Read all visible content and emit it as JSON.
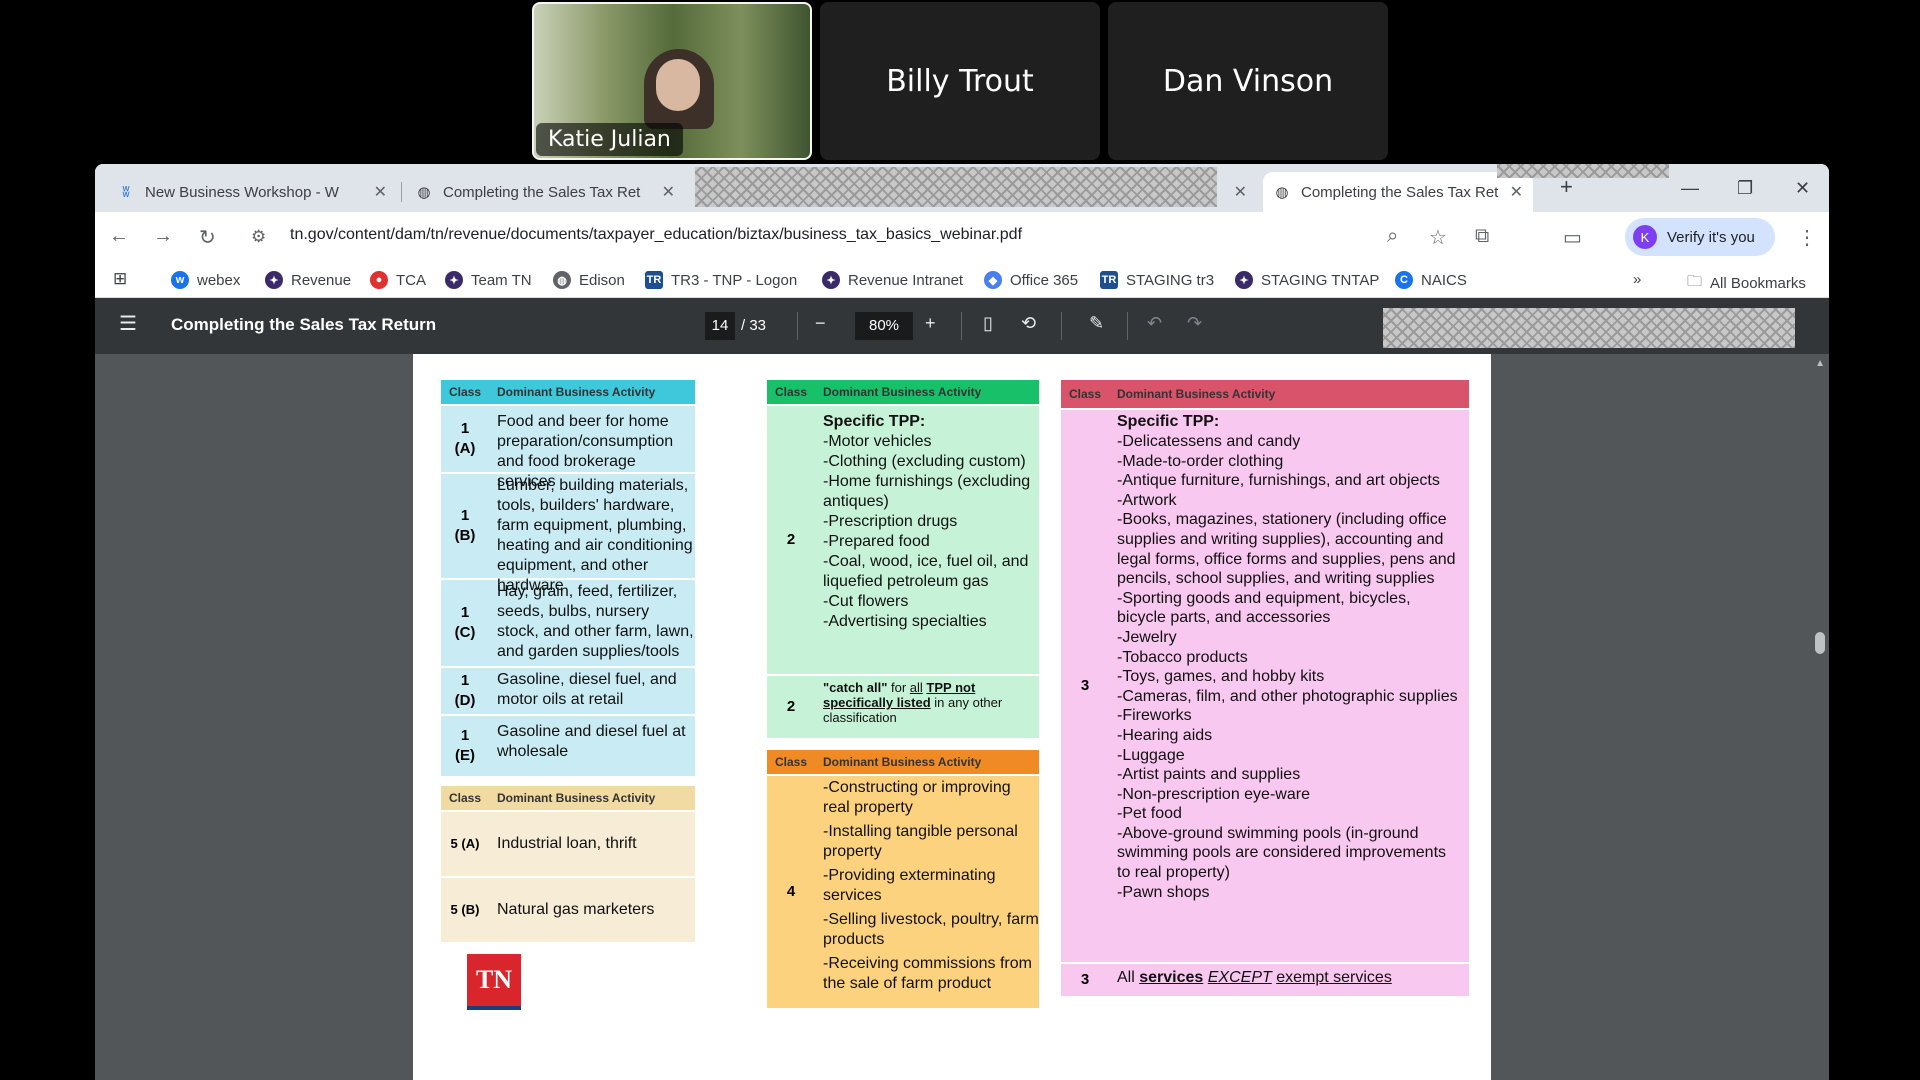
{
  "participants": [
    {
      "name": "Katie Julian",
      "video": true
    },
    {
      "name": "Billy Trout",
      "video": false
    },
    {
      "name": "Dan Vinson",
      "video": false
    }
  ],
  "browser": {
    "tabs": [
      {
        "title": "New Business Workshop - W",
        "icon": "webex-icon"
      },
      {
        "title": "Completing the Sales Tax Ret",
        "icon": "globe-icon"
      },
      {
        "title": "Completing the Sales Tax Ret",
        "icon": "globe-icon",
        "active": true
      }
    ],
    "new_tab": "+",
    "url": "tn.gov/content/dam/tn/revenue/documents/taxpayer_education/biztax/business_tax_basics_webinar.pdf",
    "verify_label": "Verify it's you",
    "avatar_letter": "K",
    "bookmarks": [
      "webex",
      "Revenue",
      "TCA",
      "Team TN",
      "Edison",
      "TR3 - TNP - Logon",
      "Revenue Intranet",
      "Office 365",
      "STAGING tr3",
      "STAGING TNTAP",
      "NAICS"
    ],
    "all_bookmarks": "All Bookmarks"
  },
  "pdf": {
    "title": "Completing the Sales Tax Return",
    "page_current": "14",
    "page_total": "/ 33",
    "zoom": "80%"
  },
  "document": {
    "header_class": "Class",
    "header_activity": "Dominant Business Activity",
    "blue_rows": [
      {
        "cls": "1\n(A)",
        "act": "Food and beer for home preparation/consumption and food brokerage services"
      },
      {
        "cls": "1\n(B)",
        "act": "Lumber, building materials, tools, builders' hardware, farm equipment, plumbing, heating and air conditioning equipment, and other hardware"
      },
      {
        "cls": "1\n(C)",
        "act": "Hay, grain, feed, fertilizer, seeds, bulbs, nursery stock, and other farm, lawn, and garden supplies/tools"
      },
      {
        "cls": "1\n(D)",
        "act": "Gasoline, diesel fuel, and motor oils at retail"
      },
      {
        "cls": "1\n(E)",
        "act": "Gasoline and diesel fuel at wholesale"
      }
    ],
    "tan_rows": [
      {
        "cls": "5 (A)",
        "act": "Industrial loan, thrift"
      },
      {
        "cls": "5 (B)",
        "act": "Natural gas marketers"
      }
    ],
    "green": {
      "cls": "2",
      "heading": "Specific TPP:",
      "items": "-Motor vehicles\n-Clothing (excluding custom)\n-Home furnishings (excluding antiques)\n-Prescription drugs\n-Prepared food\n-Coal, wood, ice, fuel oil, and liquefied petroleum gas\n-Cut flowers\n-Advertising specialties",
      "catch_cls": "2",
      "catch_a": "\"catch all\"",
      "catch_b": " for ",
      "catch_c": "all",
      "catch_d": "TPP not specifically listed",
      "catch_e": " in any other classification"
    },
    "orange": {
      "cls": "4",
      "items": [
        "-Constructing or improving real property",
        "-Installing tangible personal property",
        "-Providing exterminating services",
        "-Selling livestock, poultry, farm products",
        "-Receiving commissions from the sale of farm product"
      ]
    },
    "pink": {
      "cls": "3",
      "heading": "Specific TPP:",
      "items": "-Delicatessens and candy\n-Made-to-order clothing\n-Antique furniture, furnishings, and art objects\n-Artwork\n-Books, magazines, stationery (including office supplies and writing supplies), accounting and legal forms, office forms and supplies, pens and pencils, school supplies, and writing supplies\n-Sporting goods and equipment, bicycles, bicycle parts, and accessories\n-Jewelry\n-Tobacco products\n-Toys, games, and hobby kits\n-Cameras, film, and other photographic supplies\n-Fireworks\n-Hearing aids\n-Luggage\n-Artist paints and supplies\n-Non-prescription eye-ware\n-Pet food\n-Above-ground swimming pools (in-ground swimming pools are considered improvements to real property)\n-Pawn shops",
      "services_cls": "3",
      "services_a": "All ",
      "services_b": "services",
      "services_c": "EXCEPT",
      "services_d": "exempt services"
    },
    "logo_text": "TN"
  },
  "colors": {
    "blue_header": "#3fc8dc",
    "blue_cell": "#c9ecf4",
    "green_header": "#19c06a",
    "green_cell": "#c6f3d8",
    "orange_header": "#f08a24",
    "orange_cell": "#fdd27e",
    "pink_header": "#d9546a",
    "pink_cell": "#f9c8f0",
    "tan_header": "#f2dba2",
    "tan_cell": "#f7ecd6",
    "logo_red": "#d9262c"
  }
}
